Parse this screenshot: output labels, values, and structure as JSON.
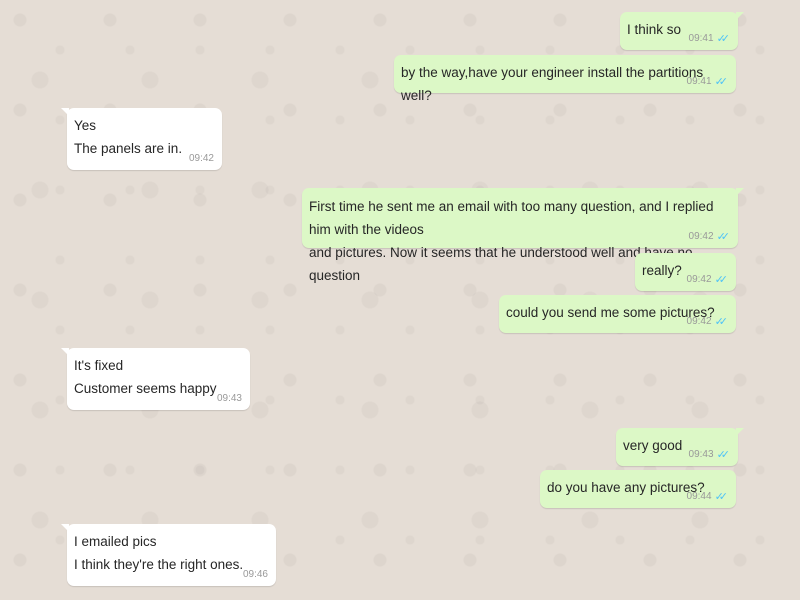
{
  "messages": [
    {
      "direction": "out",
      "text": "I think so",
      "time": "09:41",
      "status_icon": "double-check-icon"
    },
    {
      "direction": "out",
      "text": "by the way,have your engineer install the partitions well?",
      "time": "09:41",
      "status_icon": "double-check-icon"
    },
    {
      "direction": "in",
      "text": "Yes\nThe panels are in.",
      "time": "09:42"
    },
    {
      "direction": "out",
      "text": "First time he sent me an email with too many question, and I replied him with the videos\nand pictures. Now it seems that he understood well and have no question",
      "time": "09:42",
      "status_icon": "double-check-icon"
    },
    {
      "direction": "out",
      "text": "really?",
      "time": "09:42",
      "status_icon": "double-check-icon"
    },
    {
      "direction": "out",
      "text": "could you send me some pictures?",
      "time": "09:42",
      "status_icon": "double-check-icon"
    },
    {
      "direction": "in",
      "text": "It's fixed\nCustomer seems happy",
      "time": "09:43"
    },
    {
      "direction": "out",
      "text": "very good",
      "time": "09:43",
      "status_icon": "double-check-icon"
    },
    {
      "direction": "out",
      "text": "do you have any pictures?",
      "time": "09:44",
      "status_icon": "double-check-icon"
    },
    {
      "direction": "in",
      "text": "I emailed pics\nI think they're the right ones.",
      "time": "09:46"
    }
  ],
  "colors": {
    "background": "#e5ddd5",
    "incoming_bubble": "#ffffff",
    "outgoing_bubble": "#dcf8c6",
    "read_ticks": "#4fc3f7"
  }
}
